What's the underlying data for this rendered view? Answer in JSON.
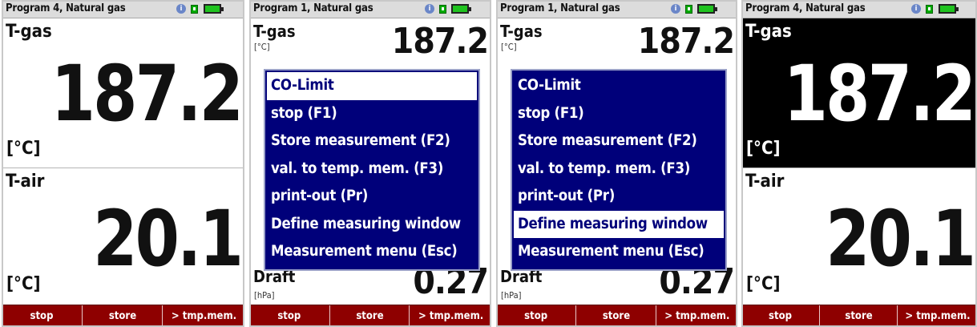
{
  "screens": [
    {
      "header": "Program 4, Natural gas",
      "top": {
        "name": "T-gas",
        "value": "187.2",
        "unit": "[°C]"
      },
      "bottom": {
        "name": "T-air",
        "value": "20.1",
        "unit": "[°C]"
      },
      "fkeys": [
        "stop",
        "store",
        "> tmp.mem."
      ]
    },
    {
      "header": "Program 1, Natural gas",
      "bg": {
        "name": "T-gas",
        "value": "187.2",
        "unit": "[°C]",
        "draft_name": "Draft",
        "draft_value": "0.27",
        "draft_unit": "[hPa]"
      },
      "menu_items": [
        "CO-Limit",
        "stop (F1)",
        "Store measurement (F2)",
        "val. to temp. mem. (F3)",
        "print-out (Pr)",
        "Define measuring window",
        "Measurement menu (Esc)"
      ],
      "fkeys": [
        "stop",
        "store",
        "> tmp.mem."
      ]
    },
    {
      "header": "Program 1, Natural gas",
      "bg": {
        "name": "T-gas",
        "value": "187.2",
        "unit": "[°C]",
        "draft_name": "Draft",
        "draft_value": "0.27",
        "draft_unit": "[hPa]"
      },
      "menu_items": [
        "CO-Limit",
        "stop (F1)",
        "Store measurement (F2)",
        "val. to temp. mem. (F3)",
        "print-out (Pr)",
        "Define measuring window",
        "Measurement menu (Esc)"
      ],
      "fkeys": [
        "stop",
        "store",
        "> tmp.mem."
      ]
    },
    {
      "header": "Program 4, Natural gas",
      "top": {
        "name": "T-gas",
        "value": "187.2",
        "unit": "[°C]"
      },
      "bottom": {
        "name": "T-air",
        "value": "20.1",
        "unit": "[°C]"
      },
      "fkeys": [
        "stop",
        "store",
        "> tmp.mem."
      ]
    }
  ],
  "status_icons": {
    "info": "info-icon",
    "memory": "memory-card-icon",
    "battery": "battery-icon"
  },
  "colors": {
    "fkey_bar": "#8e0000",
    "menu_bg": "#00007a",
    "battery": "#1fc31f"
  }
}
